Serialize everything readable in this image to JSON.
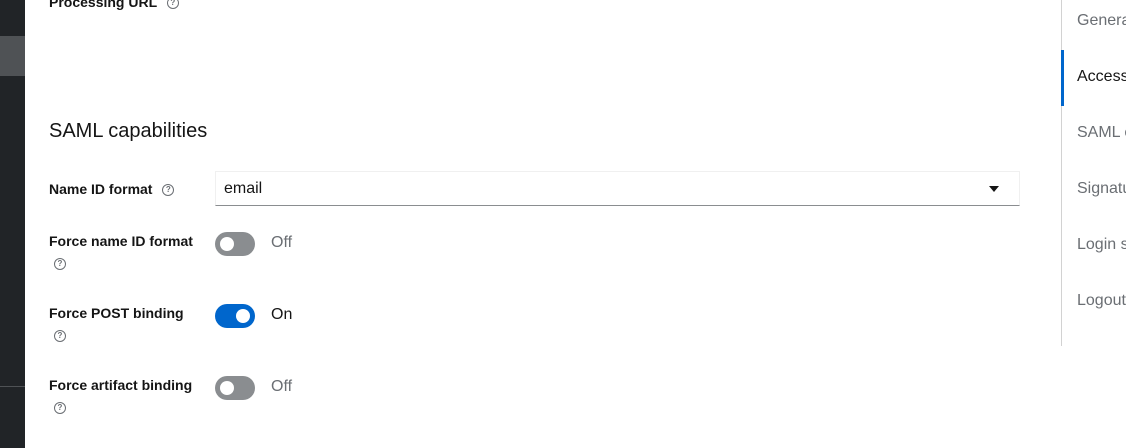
{
  "form": {
    "processing_url_label": "Processing URL",
    "section_title": "SAML capabilities",
    "name_id_format": {
      "label": "Name ID format",
      "value": "email"
    },
    "force_name_id_format": {
      "label": "Force name ID format",
      "state": "Off"
    },
    "force_post_binding": {
      "label": "Force POST binding",
      "state": "On"
    },
    "force_artifact_binding": {
      "label": "Force artifact binding",
      "state": "Off"
    }
  },
  "jump_links": [
    {
      "label": "Genera"
    },
    {
      "label": "Access"
    },
    {
      "label": "SAML c"
    },
    {
      "label": "Signatu"
    },
    {
      "label": "Login s"
    },
    {
      "label": "Logout"
    }
  ]
}
